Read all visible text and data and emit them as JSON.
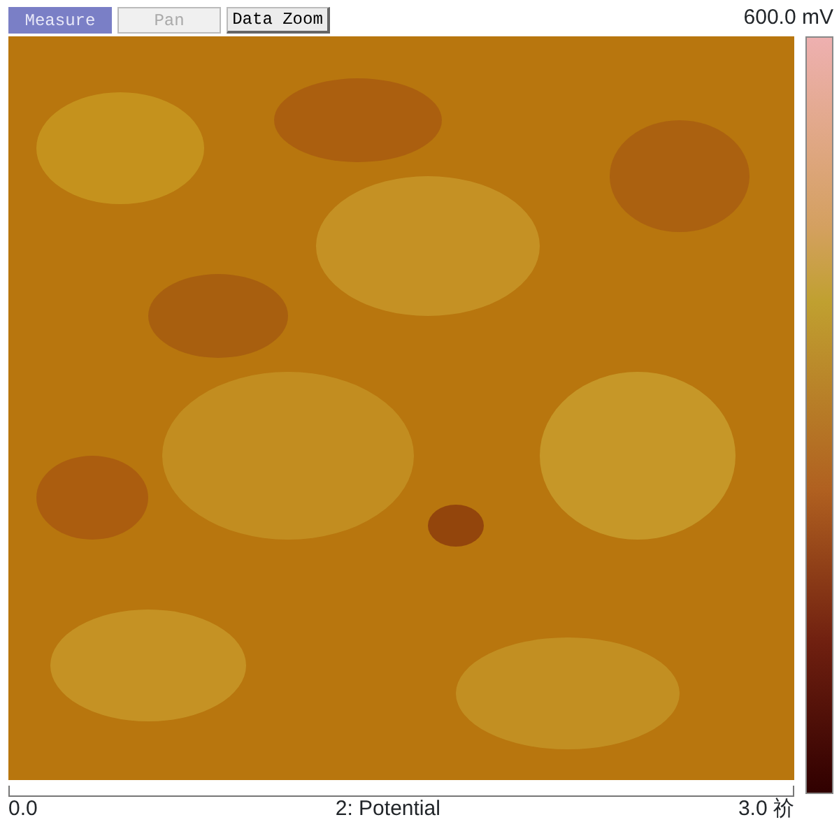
{
  "toolbar": [
    {
      "label": "Measure",
      "selected": true,
      "disabled": false
    },
    {
      "label": "Pan",
      "selected": false,
      "disabled": true
    },
    {
      "label": "Data Zoom",
      "selected": false,
      "disabled": false
    }
  ],
  "scale_max": "600.0 mV",
  "axis": {
    "start": "0.0",
    "title": "2: Potential",
    "end": "3.0 祄"
  }
}
